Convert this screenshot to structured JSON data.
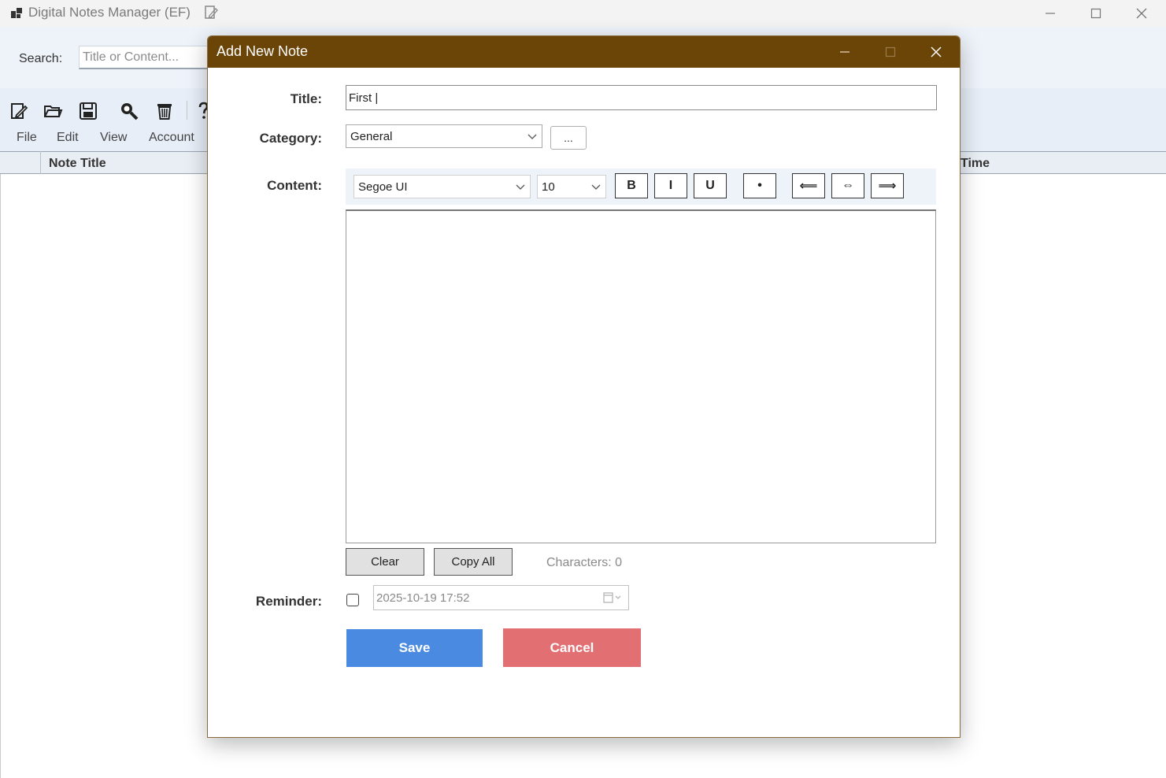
{
  "main_window": {
    "title": "Digital Notes Manager (EF)",
    "search": {
      "label": "Search:",
      "placeholder": "Title or Content..."
    },
    "toolbar_icons": [
      "new-note-icon",
      "open-folder-icon",
      "save-disk-icon",
      "search-icon",
      "trash-icon",
      "help-icon"
    ],
    "menu": {
      "file": "File",
      "edit": "Edit",
      "view": "View",
      "account": "Account"
    },
    "grid": {
      "col_title": "Note Title",
      "col_time": "Time"
    }
  },
  "dialog": {
    "title": "Add New Note",
    "title_label": "Title:",
    "title_value": "First |",
    "category_label": "Category:",
    "category_value": "General",
    "category_more": "...",
    "content_label": "Content:",
    "font_value": "Segoe UI",
    "size_value": "10",
    "format": {
      "bold": "B",
      "italic": "I",
      "underline": "U",
      "bullet": "•",
      "align_left": "⟸",
      "align_center": "⇔",
      "align_right": "⟹"
    },
    "clear_label": "Clear",
    "copy_label": "Copy All",
    "char_count": "Characters: 0",
    "reminder_label": "Reminder:",
    "reminder_value": "2025-10-19 17:52",
    "save_label": "Save",
    "cancel_label": "Cancel"
  },
  "colors": {
    "dialog_titlebar": "#6b4407",
    "save": "#4a8ae0",
    "cancel": "#e26f72",
    "app_background": "#eef3fa"
  }
}
